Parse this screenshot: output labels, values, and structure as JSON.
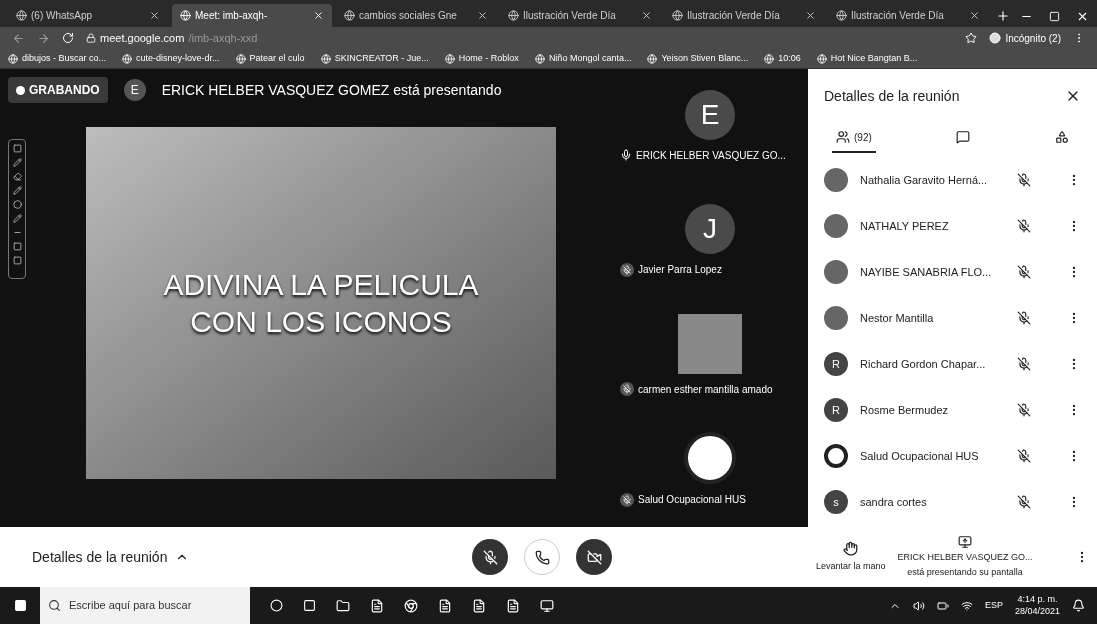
{
  "browser": {
    "tabs": [
      {
        "label": "(6) WhatsApp",
        "selected": false
      },
      {
        "label": "Meet: imb-axqh-",
        "selected": true
      },
      {
        "label": "cambios sociales Gne",
        "selected": false
      },
      {
        "label": "Ilustración Verde Día",
        "selected": false
      },
      {
        "label": "Ilustración Verde Día",
        "selected": false
      },
      {
        "label": "Ilustración Verde Día",
        "selected": false
      }
    ],
    "url_host": "meet.google.com",
    "url_path": "/imb-axqh-xxd",
    "profile": "Incógnito (2)",
    "bookmarks": [
      "dibujos - Buscar co...",
      "cute-disney-love-dr...",
      "Patear el culo",
      "SKINCREATOR - Jue...",
      "Home - Roblox",
      "Niño Mongol canta...",
      "Yeison Stiven Blanc...",
      "10:06",
      "Hot Nice Bangtan B..."
    ]
  },
  "meet": {
    "recording_label": "GRABANDO",
    "presenter_initial": "E",
    "presenter_text": "ERICK HELBER VASQUEZ GOMEZ está presentando",
    "slide_title": "ADIVINA LA PELICULA CON LOS ICONOS",
    "tiles": [
      {
        "kind": "initial",
        "initial": "E",
        "name": "ERICK HELBER VASQUEZ GO...",
        "muted": false
      },
      {
        "kind": "initial",
        "initial": "J",
        "name": "Javier Parra Lopez",
        "muted": true
      },
      {
        "kind": "video",
        "name": "carmen esther mantilla amado",
        "muted": true
      },
      {
        "kind": "logo",
        "name": "Salud Ocupacional HUS",
        "muted": true
      }
    ]
  },
  "panel": {
    "title": "Detalles de la reunión",
    "tabs": [
      {
        "kind": "people",
        "label": "(92)",
        "selected": true
      },
      {
        "kind": "chat",
        "selected": false
      },
      {
        "kind": "activities",
        "selected": false
      }
    ],
    "participants": [
      {
        "kind": "photo",
        "name": "Nathalia Garavito Herná..."
      },
      {
        "kind": "photo",
        "name": "NATHALY PEREZ"
      },
      {
        "kind": "photo",
        "name": "NAYIBE SANABRIA FLO..."
      },
      {
        "kind": "photo",
        "name": "Nestor Mantilla"
      },
      {
        "kind": "initial",
        "initial": "R",
        "name": "Richard Gordon Chapar..."
      },
      {
        "kind": "initial",
        "initial": "R",
        "name": "Rosme Bermudez"
      },
      {
        "kind": "logo",
        "name": "Salud Ocupacional HUS"
      },
      {
        "kind": "initial",
        "initial": "s",
        "name": "sandra cortes"
      }
    ]
  },
  "bottom": {
    "details": "Detalles de la reunión",
    "raise_hand": "Levantar la mano",
    "presenting_name": "ERICK HELBER VASQUEZ GO...",
    "presenting_sub": "está presentando su pantalla"
  },
  "taskbar": {
    "search_placeholder": "Escribe aquí para buscar",
    "lang": "ESP",
    "time": "4:14 p. m.",
    "date": "28/04/2021"
  }
}
